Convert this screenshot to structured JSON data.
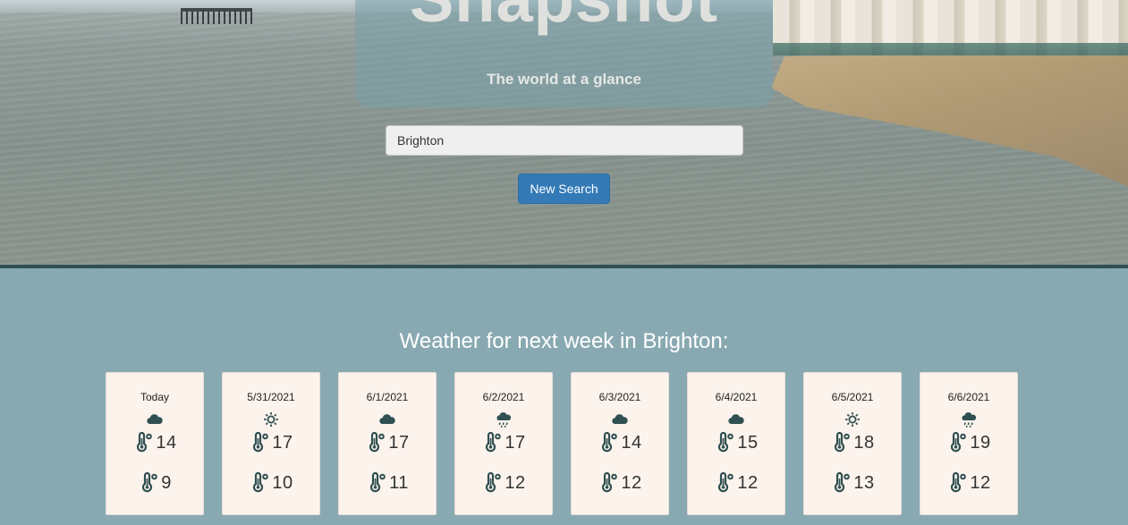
{
  "header": {
    "app_title": "Snapshot",
    "tagline": "The world at a glance"
  },
  "search": {
    "value": "Brighton",
    "button_label": "New Search"
  },
  "forecast": {
    "heading": "Weather for next week in Brighton:",
    "days": [
      {
        "date": "Today",
        "icon": "cloud-icon",
        "high": "14",
        "low": "9"
      },
      {
        "date": "5/31/2021",
        "icon": "sun-icon",
        "high": "17",
        "low": "10"
      },
      {
        "date": "6/1/2021",
        "icon": "cloud-icon",
        "high": "17",
        "low": "11"
      },
      {
        "date": "6/2/2021",
        "icon": "rain-icon",
        "high": "17",
        "low": "12"
      },
      {
        "date": "6/3/2021",
        "icon": "cloud-icon",
        "high": "14",
        "low": "12"
      },
      {
        "date": "6/4/2021",
        "icon": "cloud-icon",
        "high": "15",
        "low": "12"
      },
      {
        "date": "6/5/2021",
        "icon": "sun-icon",
        "high": "18",
        "low": "13"
      },
      {
        "date": "6/6/2021",
        "icon": "rain-icon",
        "high": "19",
        "low": "12"
      }
    ]
  },
  "colors": {
    "icon": "#2f4f50",
    "button": "#337ab7",
    "section_bg": "#89a9b2",
    "card_bg": "#fcf3ed"
  }
}
